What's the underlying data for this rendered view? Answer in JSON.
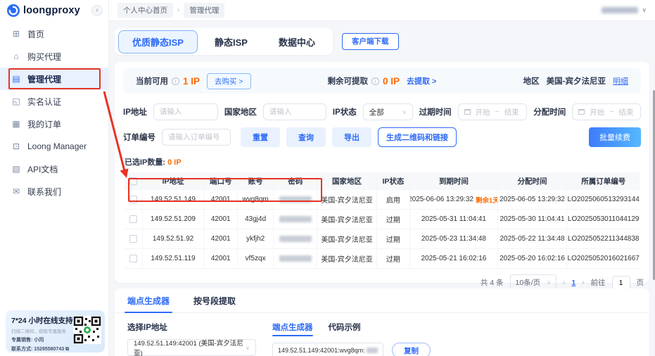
{
  "brand": {
    "name": "loongproxy",
    "collapse_glyph": "‹"
  },
  "topbar": {
    "breadcrumbs": [
      "个人中心首页",
      "管理代理"
    ],
    "breadcrumb_sep": "›",
    "user_caret": "∨"
  },
  "sidebar": {
    "items": [
      {
        "label": "首页",
        "glyph": "⊞",
        "name": "home",
        "active": false
      },
      {
        "label": "购买代理",
        "glyph": "⌂",
        "name": "buy-proxy",
        "active": false
      },
      {
        "label": "管理代理",
        "glyph": "▤",
        "name": "manage-proxy",
        "active": true
      },
      {
        "label": "实名认证",
        "glyph": "◱",
        "name": "identity-verify",
        "active": false
      },
      {
        "label": "我的订单",
        "glyph": "▦",
        "name": "my-orders",
        "active": false
      },
      {
        "label": "Loong Manager",
        "glyph": "⊡",
        "name": "loong-manager",
        "active": false
      },
      {
        "label": "API文档",
        "glyph": "▧",
        "name": "api-docs",
        "active": false
      },
      {
        "label": "联系我们",
        "glyph": "✉",
        "name": "contact-us",
        "active": false
      }
    ]
  },
  "support": {
    "title": "7*24 小时在线支持",
    "subtitle": "扫描二维码，获取专属服务",
    "agent": "专属销售: 小闫",
    "contact": "联系方式: 15295580743 ⧉"
  },
  "tabs": {
    "items": [
      "优质静态ISP",
      "静态ISP",
      "数据中心"
    ],
    "active_index": 0
  },
  "client_download_label": "客户端下载",
  "summary": {
    "available_label": "当前可用",
    "available_value": "1 IP",
    "buy_label": "去购买 >",
    "extract_label": "剩余可提取",
    "extract_value": "0 IP",
    "extract_link": "去提取 >",
    "region_label": "地区",
    "region_value": "美国-宾夕法尼亚",
    "detail_link": "明细"
  },
  "filters": {
    "ip_label": "IP地址",
    "ip_placeholder": "请输入",
    "country_label": "国家地区",
    "country_placeholder": "请输入",
    "status_label": "IP状态",
    "status_value": "全部",
    "expire_label": "过期时间",
    "assign_label": "分配时间",
    "range_start": "开始",
    "range_sep": "~",
    "range_end": "结束",
    "order_label": "订单编号",
    "order_placeholder": "请输入订单编号"
  },
  "actions": {
    "reset": "重置",
    "query": "查询",
    "export": "导出",
    "gen_qr": "生成二维码和链接",
    "batch_renew": "批量续费"
  },
  "selection": {
    "label": "已选IP数量:",
    "value": "0 IP"
  },
  "table": {
    "columns": [
      "IP地址",
      "端口号",
      "账号",
      "密码",
      "国家地区",
      "IP状态",
      "到期时间",
      "分配时间",
      "所属订单编号"
    ],
    "rows": [
      {
        "ip": "149.52.51.149",
        "port": "42001",
        "account": "wvg8qm",
        "password_masked": true,
        "country": "美国-宾夕法尼亚",
        "status": "启用",
        "expire": "2025-06-06 13:29:32",
        "expire_tag": "剩余1天",
        "assign": "2025-06-05 13:29:32",
        "order": "LO2025060513293144"
      },
      {
        "ip": "149.52.51.209",
        "port": "42001",
        "account": "43gj4d",
        "password_masked": true,
        "country": "美国-宾夕法尼亚",
        "status": "过期",
        "expire": "2025-05-31 11:04:41",
        "expire_tag": "",
        "assign": "2025-05-30 11:04:41",
        "order": "LO2025053011044129"
      },
      {
        "ip": "149.52.51.92",
        "port": "42001",
        "account": "ykfjh2",
        "password_masked": true,
        "country": "美国-宾夕法尼亚",
        "status": "过期",
        "expire": "2025-05-23 11:34:48",
        "expire_tag": "",
        "assign": "2025-05-22 11:34:48",
        "order": "LO2025052211344838"
      },
      {
        "ip": "149.52.51.119",
        "port": "42001",
        "account": "vf5zqx",
        "password_masked": true,
        "country": "美国-宾夕法尼亚",
        "status": "过期",
        "expire": "2025-05-21 16:02:16",
        "expire_tag": "",
        "assign": "2025-05-20 16:02:16",
        "order": "LO2025052016021667"
      }
    ]
  },
  "pagination": {
    "total": "共 4 条",
    "page_size": "10条/页",
    "prev": "‹",
    "page": "1",
    "next": "›",
    "goto_label": "前往",
    "goto_value": "1",
    "goto_suffix": "页"
  },
  "generator": {
    "tabs": [
      "端点生成器",
      "按号段提取"
    ],
    "select_label": "选择IP地址",
    "select_value": "149.52.51.149:42001 (美国-宾夕法尼亚)",
    "sub_tabs": [
      "端点生成器",
      "代码示例"
    ],
    "endpoint_prefix": "149.52.51.149:42001:wvg8qm:",
    "copy_label": "复制"
  },
  "colors": {
    "primary": "#2e6bf6",
    "orange": "#ff6a00",
    "annotation_red": "#e63326"
  }
}
